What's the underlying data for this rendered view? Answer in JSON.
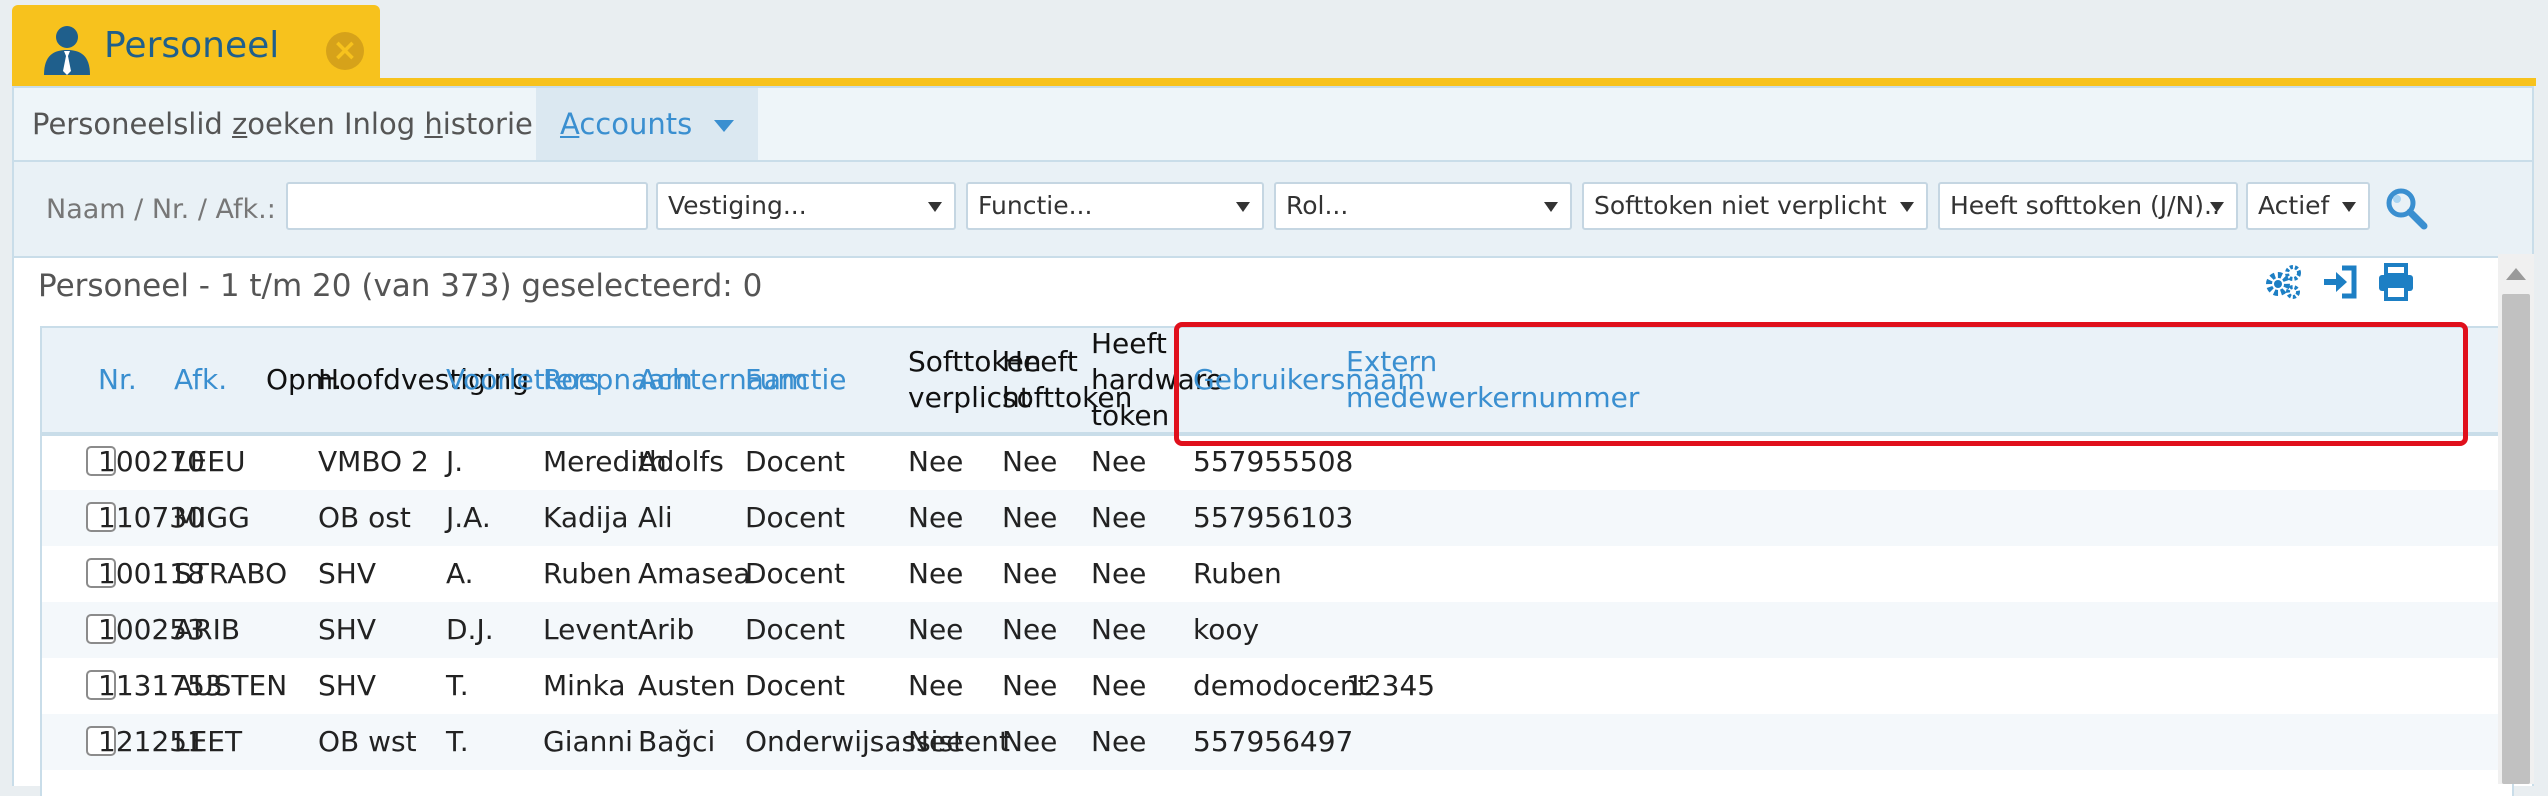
{
  "app_tab": {
    "title": "Personeel",
    "close_glyph": "×"
  },
  "subnav": {
    "tabs": [
      {
        "label_pre": "Personeelslid ",
        "label_key": "z",
        "label_post": "oeken"
      },
      {
        "label_pre": "Inlog ",
        "label_key": "h",
        "label_post": "istorie"
      },
      {
        "label_pre": "",
        "label_key": "A",
        "label_post": "ccounts",
        "active": true
      }
    ]
  },
  "filters": {
    "name_label": "Naam / Nr. / Afk.:",
    "name_value": "",
    "vestiging": "Vestiging...",
    "functie": "Functie...",
    "rol": "Rol...",
    "softtoken_verplicht": "Softtoken niet verplicht",
    "heeft_softtoken": "Heeft softtoken (J/N)..",
    "actief": "Actief"
  },
  "list": {
    "title": "Personeel - 1 t/m 20 (van 373) geselecteerd: 0"
  },
  "columns": {
    "nr": "Nr.",
    "afk": "Afk.",
    "opm": "Opm.",
    "hoofdvestiging": "Hoofdvestiging",
    "voorletters": "Voorletters",
    "roepnaam": "Roepnaam",
    "achternaam": "Achternaam",
    "functie": "Functie",
    "softtoken_verplicht": [
      "Softtoken",
      "verplicht"
    ],
    "heeft_softtoken": [
      "Heeft",
      "softtoken"
    ],
    "heeft_hardware_token": [
      "Heeft",
      "hardware",
      "token"
    ],
    "gebruikersnaam": "Gebruikersnaam",
    "extern": [
      "Extern",
      "medewerkernummer"
    ]
  },
  "rows": [
    {
      "nr": "100270",
      "afk": "LEEU",
      "hoofdvestiging": "VMBO 2",
      "voorletters": "J.",
      "roepnaam": "Meredith",
      "achternaam": "Adolfs",
      "functie": "Docent",
      "softtoken_verplicht": "Nee",
      "heeft_softtoken": "Nee",
      "hardware_token": "Nee",
      "gebruikersnaam": "557955508",
      "extern": ""
    },
    {
      "nr": "110730",
      "afk": "MIGG",
      "hoofdvestiging": "OB ost",
      "voorletters": "J.A.",
      "roepnaam": "Kadija",
      "achternaam": "Ali",
      "functie": "Docent",
      "softtoken_verplicht": "Nee",
      "heeft_softtoken": "Nee",
      "hardware_token": "Nee",
      "gebruikersnaam": "557956103",
      "extern": ""
    },
    {
      "nr": "100118",
      "afk": "STRABO",
      "hoofdvestiging": "SHV",
      "voorletters": "A.",
      "roepnaam": "Ruben",
      "achternaam": "Amasea",
      "functie": "Docent",
      "softtoken_verplicht": "Nee",
      "heeft_softtoken": "Nee",
      "hardware_token": "Nee",
      "gebruikersnaam": "Ruben",
      "extern": ""
    },
    {
      "nr": "100253",
      "afk": "ARIB",
      "hoofdvestiging": "SHV",
      "voorletters": "D.J.",
      "roepnaam": "Levent",
      "achternaam": "Arib",
      "functie": "Docent",
      "softtoken_verplicht": "Nee",
      "heeft_softtoken": "Nee",
      "hardware_token": "Nee",
      "gebruikersnaam": "kooy",
      "extern": ""
    },
    {
      "nr": "1131753",
      "afk": "AUSTEN",
      "hoofdvestiging": "SHV",
      "voorletters": "T.",
      "roepnaam": "Minka",
      "achternaam": "Austen",
      "functie": "Docent",
      "softtoken_verplicht": "Nee",
      "heeft_softtoken": "Nee",
      "hardware_token": "Nee",
      "gebruikersnaam": "demodocent",
      "extern": "12345"
    },
    {
      "nr": "121251",
      "afk": "LEET",
      "hoofdvestiging": "OB wst",
      "voorletters": "T.",
      "roepnaam": "Gianni",
      "achternaam": "Bağci",
      "functie": "Onderwijsassistent",
      "softtoken_verplicht": "Nee",
      "heeft_softtoken": "Nee",
      "hardware_token": "Nee",
      "gebruikersnaam": "557956497",
      "extern": ""
    }
  ],
  "colors": {
    "tab_yellow": "#f7c21d",
    "link_blue": "#3a8fd0",
    "highlight_red": "#e0101c"
  },
  "icons": {
    "tab": "user-tie-icon",
    "close": "close-icon",
    "search": "search-icon",
    "toolbar": [
      "settings-gears-icon",
      "sign-in-icon",
      "print-icon"
    ]
  }
}
